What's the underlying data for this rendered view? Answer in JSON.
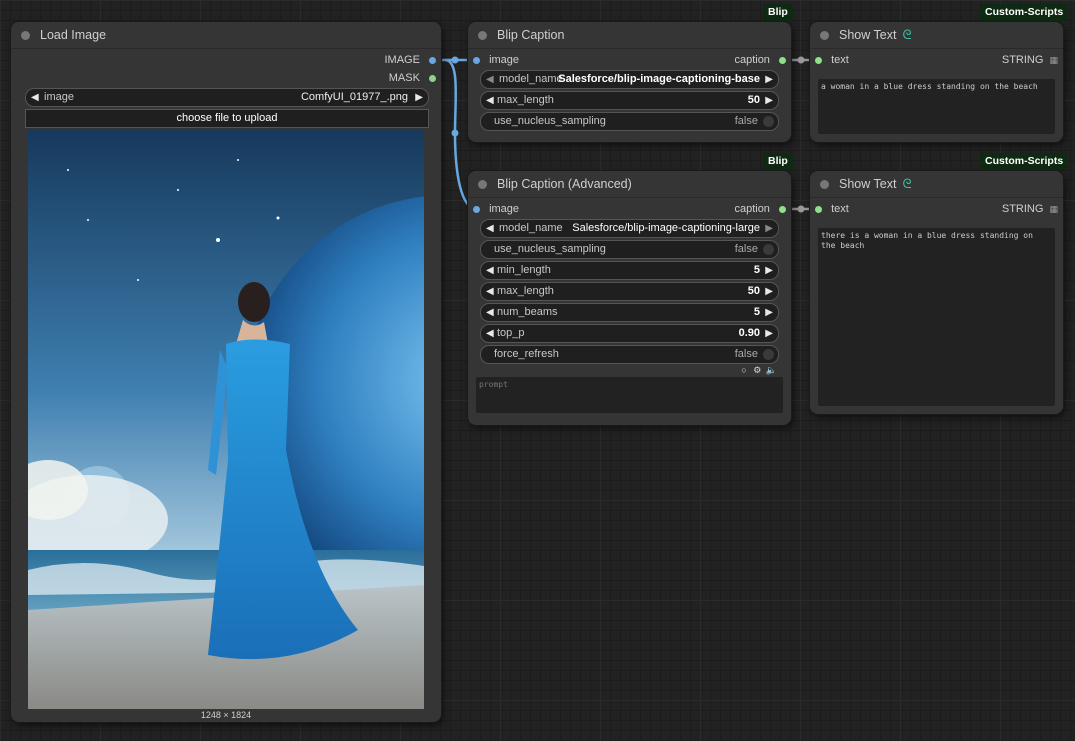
{
  "load_image": {
    "title": "Load Image",
    "outputs": [
      "IMAGE",
      "MASK"
    ],
    "image_widget": {
      "label": "image",
      "value": "ComfyUI_01977_.png"
    },
    "upload_label": "choose file to upload",
    "dimensions": "1248 × 1824"
  },
  "blip_caption": {
    "badge": "Blip",
    "title": "Blip Caption",
    "input": "image",
    "output": "caption",
    "widgets": [
      {
        "label": "model_name",
        "value": "Salesforce/blip-image-captioning-base"
      },
      {
        "label": "max_length",
        "value": "50"
      },
      {
        "label": "use_nucleus_sampling",
        "value": "false"
      }
    ]
  },
  "blip_caption_adv": {
    "badge": "Blip",
    "title": "Blip Caption (Advanced)",
    "input": "image",
    "output": "caption",
    "widgets": [
      {
        "label": "model_name",
        "value": "Salesforce/blip-image-captioning-large"
      },
      {
        "label": "use_nucleus_sampling",
        "value": "false"
      },
      {
        "label": "min_length",
        "value": "5"
      },
      {
        "label": "max_length",
        "value": "50"
      },
      {
        "label": "num_beams",
        "value": "5"
      },
      {
        "label": "top_p",
        "value": "0.90"
      },
      {
        "label": "force_refresh",
        "value": "false"
      }
    ],
    "prompt_placeholder": "prompt"
  },
  "show_text_1": {
    "badge": "Custom-Scripts",
    "title": "Show Text",
    "input": "text",
    "output": "STRING",
    "text": "a woman in a blue dress standing on the beach"
  },
  "show_text_2": {
    "badge": "Custom-Scripts",
    "title": "Show Text",
    "input": "text",
    "output": "STRING",
    "text": "there is a woman in a blue dress standing on the beach"
  },
  "colors": {
    "image_slot": "#6aa7e0",
    "mask_slot": "#8fd08f",
    "string_slot": "#8ee08a",
    "badge_bg": "#0f2a12",
    "link_blue": "#6aa7e0",
    "link_grey": "#9a9a9a"
  }
}
